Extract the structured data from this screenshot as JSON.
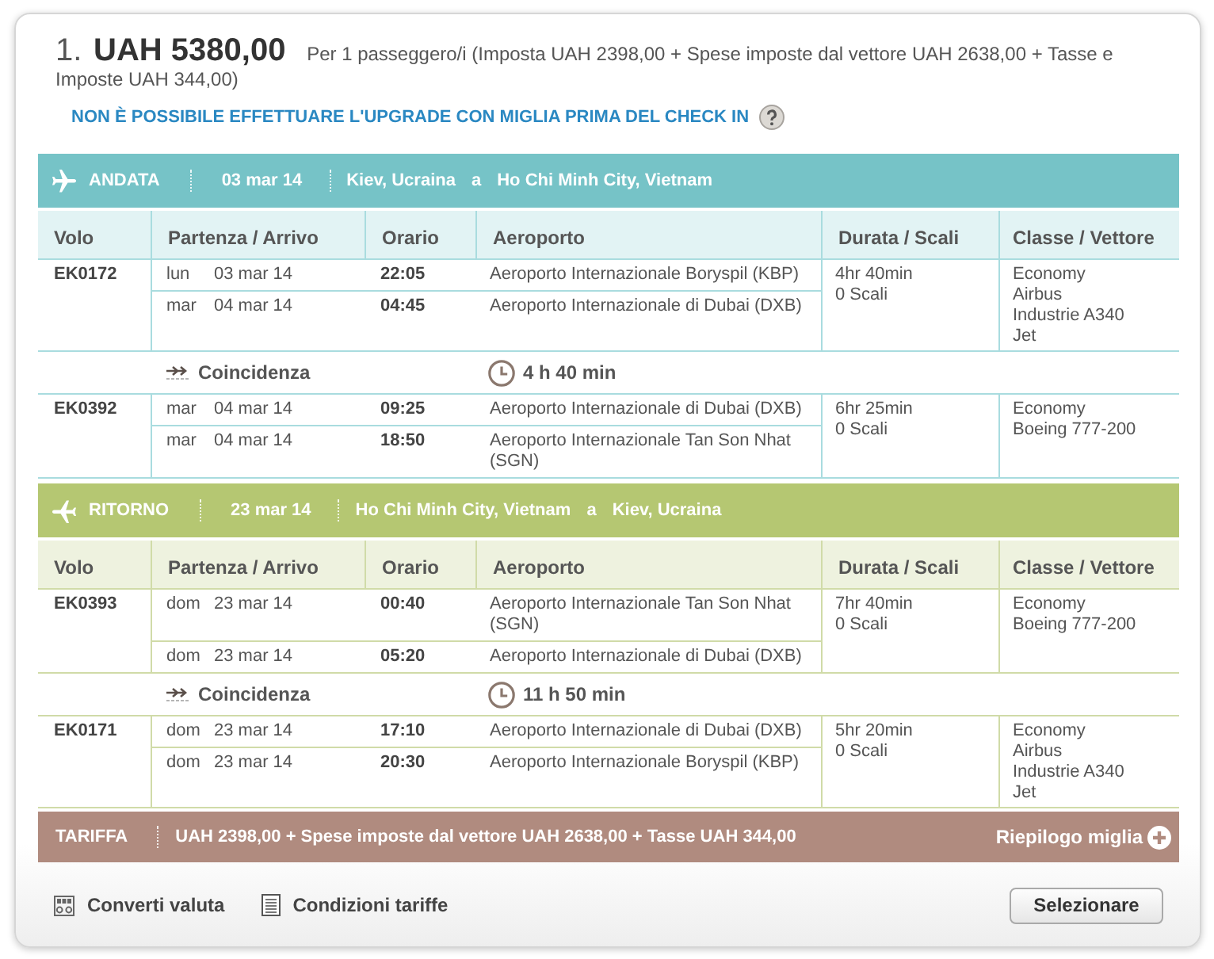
{
  "fare_summary": {
    "index": "1.",
    "price": "UAH 5380,00",
    "detail": "Per 1 passeggero/i (Imposta UAH 2398,00 + Spese imposte dal vettore UAH 2638,00 + Tasse e Imposte UAH 344,00)"
  },
  "upgrade_notice": "NON È POSSIBILE EFFETTUARE L'UPGRADE CON MIGLIA PRIMA DEL CHECK IN",
  "journeys": [
    {
      "kind": "outbound",
      "label": "ANDATA",
      "date": "03 mar 14",
      "origin": "Kiev, Ucraina",
      "connector": "a",
      "destination": "Ho Chi Minh City, Vietnam",
      "columns": [
        "Volo",
        "Partenza / Arrivo",
        "Orario",
        "Aeroporto",
        "Durata / Scali",
        "Classe / Vettore"
      ],
      "segments": [
        {
          "kind": "flight",
          "code": "EK0172",
          "legs": [
            {
              "day": "lun",
              "date": "03 mar 14",
              "time": "22:05",
              "airport": "Aeroporto Internazionale Boryspil (KBP)"
            },
            {
              "day": "mar",
              "date": "04 mar 14",
              "time": "04:45",
              "airport": "Aeroporto Internazionale di Dubai (DXB)"
            }
          ],
          "duration": "4hr 40min",
          "stops": "0 Scali",
          "cabin": "Economy",
          "aircraft": "Airbus\nIndustrie A340\nJet"
        },
        {
          "kind": "connection",
          "label": "Coincidenza",
          "wait": "4 h 40 min"
        },
        {
          "kind": "flight",
          "code": "EK0392",
          "legs": [
            {
              "day": "mar",
              "date": "04 mar 14",
              "time": "09:25",
              "airport": "Aeroporto Internazionale di Dubai (DXB)"
            },
            {
              "day": "mar",
              "date": "04 mar 14",
              "time": "18:50",
              "airport": "Aeroporto Internazionale Tan Son Nhat (SGN)"
            }
          ],
          "duration": "6hr 25min",
          "stops": "0 Scali",
          "cabin": "Economy",
          "aircraft": "Boeing 777-200"
        }
      ]
    },
    {
      "kind": "return",
      "label": "RITORNO",
      "date": "23 mar 14",
      "origin": "Ho Chi Minh City, Vietnam",
      "connector": "a",
      "destination": "Kiev, Ucraina",
      "columns": [
        "Volo",
        "Partenza / Arrivo",
        "Orario",
        "Aeroporto",
        "Durata / Scali",
        "Classe / Vettore"
      ],
      "segments": [
        {
          "kind": "flight",
          "code": "EK0393",
          "legs": [
            {
              "day": "dom",
              "date": "23 mar 14",
              "time": "00:40",
              "airport": "Aeroporto Internazionale Tan Son Nhat (SGN)"
            },
            {
              "day": "dom",
              "date": "23 mar 14",
              "time": "05:20",
              "airport": "Aeroporto Internazionale di Dubai (DXB)"
            }
          ],
          "duration": "7hr 40min",
          "stops": "0 Scali",
          "cabin": "Economy",
          "aircraft": "Boeing 777-200"
        },
        {
          "kind": "connection",
          "label": "Coincidenza",
          "wait": "11 h 50 min"
        },
        {
          "kind": "flight",
          "code": "EK0171",
          "legs": [
            {
              "day": "dom",
              "date": "23 mar 14",
              "time": "17:10",
              "airport": "Aeroporto Internazionale di Dubai (DXB)"
            },
            {
              "day": "dom",
              "date": "23 mar 14",
              "time": "20:30",
              "airport": "Aeroporto Internazionale Boryspil (KBP)"
            }
          ],
          "duration": "5hr 20min",
          "stops": "0 Scali",
          "cabin": "Economy",
          "aircraft": "Airbus\nIndustrie A340\nJet"
        }
      ]
    }
  ],
  "fare_bar": {
    "label": "TARIFFA",
    "breakdown": "UAH 2398,00 + Spese imposte dal vettore UAH 2638,00 + Tasse UAH 344,00",
    "miles_link": "Riepilogo miglia"
  },
  "footer": {
    "links": [
      {
        "kind": "currency",
        "label": "Converti valuta"
      },
      {
        "kind": "conditions",
        "label": "Condizioni tariffe"
      }
    ],
    "select_button": "Selezionare"
  }
}
